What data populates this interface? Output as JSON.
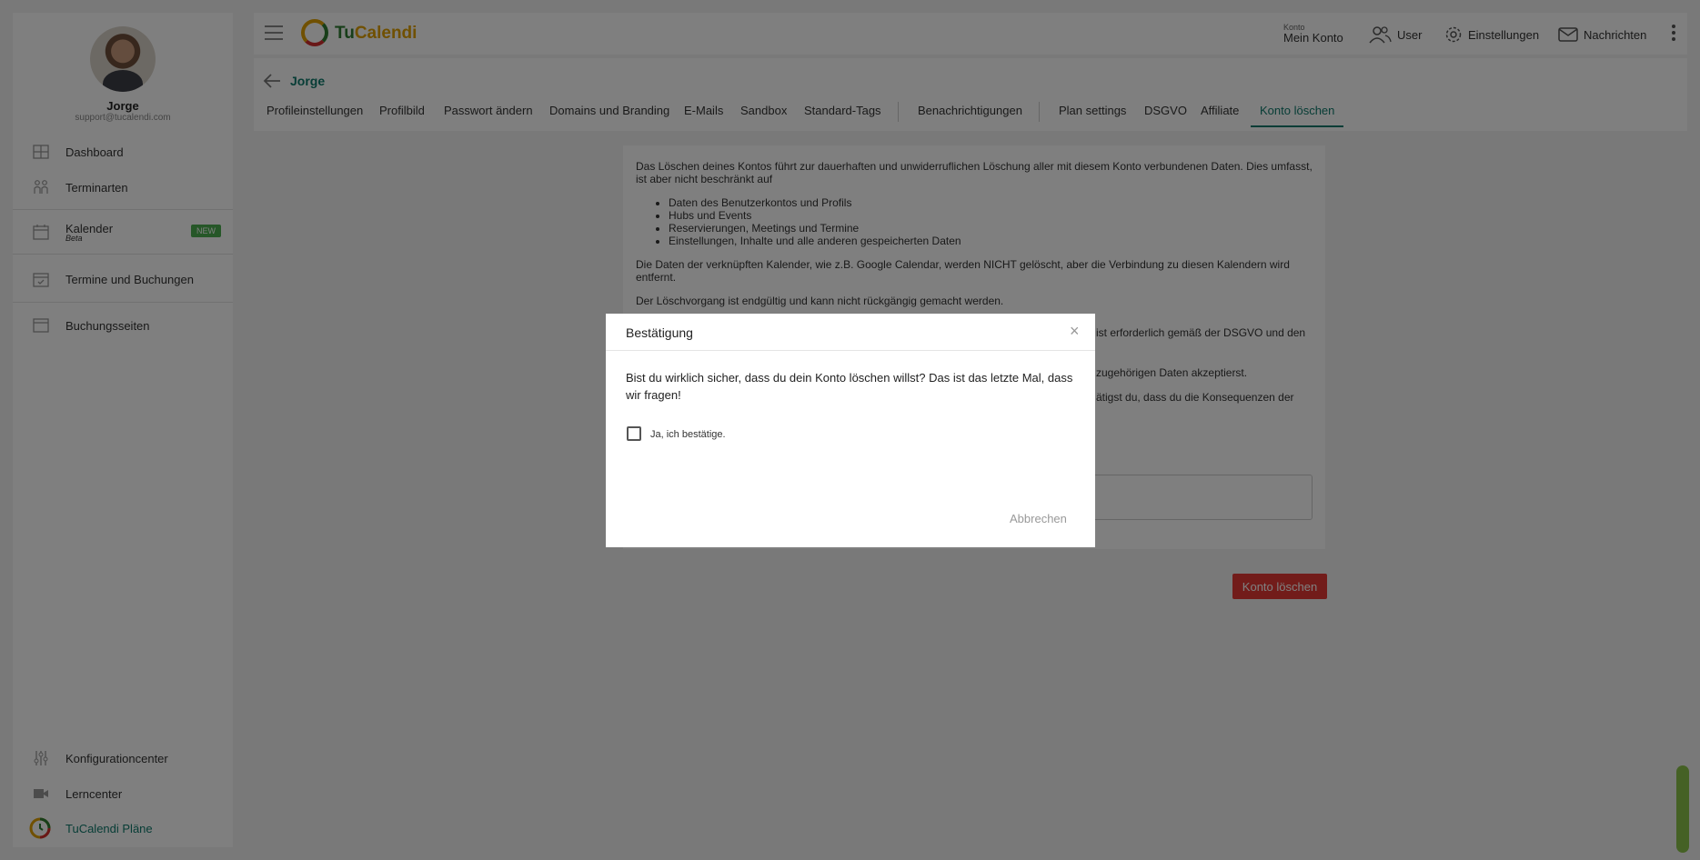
{
  "sidebar": {
    "user_name": "Jorge",
    "user_email": "support@tucalendi.com",
    "items": [
      {
        "label": "Dashboard",
        "icon": "grid-icon"
      },
      {
        "label": "Terminarten",
        "icon": "people-icon"
      },
      {
        "label": "Kalender",
        "sublabel": "Beta",
        "badge": "NEW",
        "icon": "calendar-icon"
      },
      {
        "label": "Termine und Buchungen",
        "icon": "calendar-check-icon"
      },
      {
        "label": "Buchungsseiten",
        "icon": "browser-icon"
      }
    ],
    "bottom_items": [
      {
        "label": "Konfigurationcenter",
        "icon": "sliders-icon"
      },
      {
        "label": "Lerncenter",
        "icon": "video-icon"
      },
      {
        "label": "TuCalendi Pläne",
        "icon": "tucalendi-logo-icon"
      }
    ]
  },
  "topbar": {
    "logo_part1": "Tu",
    "logo_part2": "Calendi",
    "account_small": "Konto",
    "account_label": "Mein Konto",
    "user_label": "User",
    "settings_label": "Einstellungen",
    "messages_label": "Nachrichten"
  },
  "subheader": {
    "back_name": "Jorge",
    "tabs": [
      "Profileinstellungen",
      "Profilbild",
      "Passwort ändern",
      "Domains und Branding",
      "E-Mails",
      "Sandbox",
      "Standard-Tags",
      "Benachrichtigungen",
      "Plan settings",
      "DSGVO",
      "Affiliate",
      "Konto löschen"
    ],
    "active_tab": "Konto löschen"
  },
  "card": {
    "intro": "Das Löschen deines Kontos führt zur dauerhaften und unwiderruflichen Löschung aller mit diesem Konto verbundenen Daten. Dies umfasst, ist aber nicht beschränkt auf",
    "list": [
      "Daten des Benutzerkontos und Profils",
      "Hubs und Events",
      "Reservierungen, Meetings und Termine",
      "Einstellungen, Inhalte und alle anderen gespeicherten Daten"
    ],
    "p_calendars": "Die Daten der verknüpften Kalender, wie z.B. Google Calendar, werden NICHT gelöscht, aber die Verbindung zu diesen Kalendern wird entfernt.",
    "p_final": "Der Löschvorgang ist endgültig und kann nicht rückgängig gemacht werden.",
    "p_partial_1": "ist erforderlich gemäß der DSGVO und den",
    "p_partial_2": "zugehörigen Daten akzeptierst.",
    "p_partial_3": "ätigst du, dass du die Konsequenzen der",
    "delete_button": "Konto löschen"
  },
  "modal": {
    "title": "Bestätigung",
    "close": "×",
    "message": "Bist du wirklich sicher, dass du dein Konto löschen willst? Das ist das letzte Mal, dass wir fragen!",
    "checkbox_label": "Ja, ich bestätige.",
    "checkbox_checked": false,
    "cancel": "Abbrechen"
  },
  "colors": {
    "brand_teal": "#0f7a6c",
    "danger": "#e53935",
    "badge_green": "#4caf50"
  }
}
